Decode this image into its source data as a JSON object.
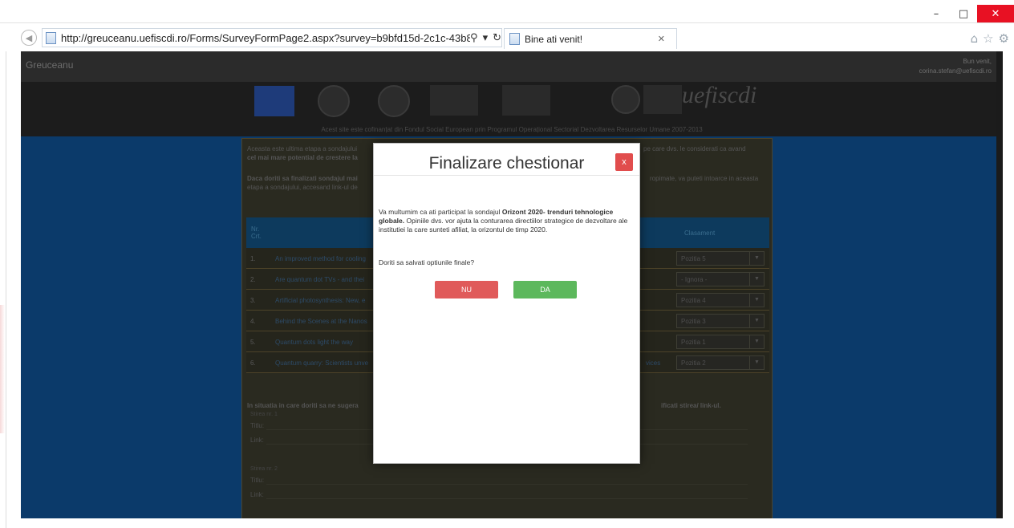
{
  "browser": {
    "url": "http://greuceanu.uefiscdi.ro/Forms/SurveyFormPage2.aspx?survey=b9bfd15d-2c1c-43b8-bd5",
    "tab_title": "Bine ati venit!",
    "icons": [
      "back-icon",
      "page-icon",
      "search-icon",
      "refresh-icon",
      "home-icon",
      "favorites-icon",
      "settings-icon"
    ]
  },
  "site": {
    "name": "Greuceanu",
    "welcome_line1": "Bun venit,",
    "welcome_line2": "corina.stefan@uefiscdi.ro",
    "banner_caption": "Acest site este cofinanțat din Fondul Social European prin Programul Operațional Sectorial Dezvoltarea Resurselor Umane 2007-2013",
    "brand": "uefiscdi"
  },
  "background": {
    "intro_1": "Aceasta este ultima etapa a sondajului",
    "intro_1_tail": "pe care dvs. le considerati ca avand",
    "intro_2": "cel mai mare potential de crestere la",
    "intro_3": "Daca doriti sa finalizati sondajul mai",
    "intro_3_tail": "ropimate, va puteti intoarce in aceasta",
    "intro_4": "etapa a sondajului, accesand link-ul de",
    "col_no": "Nr. Crt.",
    "col_rank": "Clasament",
    "rows": [
      {
        "no": "1.",
        "title": "An improved method for cooling",
        "rank": "Pozitia 5"
      },
      {
        "no": "2.",
        "title": "Are quantum dot TVs - and thei",
        "rank": "- Ignora -"
      },
      {
        "no": "3.",
        "title": "Artificial photosynthesis: New, e",
        "rank": "Pozitia 4"
      },
      {
        "no": "4.",
        "title": "Behind the Scenes at the Nanos",
        "rank": "Pozitia 3"
      },
      {
        "no": "5.",
        "title": "Quantum dots light the way",
        "rank": "Pozitia 1"
      },
      {
        "no": "6.",
        "title": "Quantum quarry: Scientists unve",
        "rank": "Pozitia 2",
        "tail": "vices"
      }
    ],
    "suggest": "In situatia in care doriti sa ne sugera",
    "suggest_tail": "ificati stirea/ link-ul.",
    "news1": "Stirea nr. 1",
    "news2": "Stirea nr. 2",
    "titlu": "Titlu:",
    "link": "Link:"
  },
  "modal": {
    "title": "Finalizare chestionar",
    "close": "x",
    "body_pre": "Va multumim ca ati participat la sondajul ",
    "body_bold": "Orizont 2020- trenduri tehnologice globale.",
    "body_post": " Opiniile dvs. vor ajuta la conturarea directiilor strategice de dezvoltare ale institutiei la care sunteti afiliat, la orizontul de timp 2020.",
    "question": "Doriti sa salvati optiunile finale?",
    "btn_no": "NU",
    "btn_yes": "DA",
    "colors": {
      "no": "#e05a5a",
      "yes": "#5cb85c",
      "close": "#e14d4d"
    }
  }
}
